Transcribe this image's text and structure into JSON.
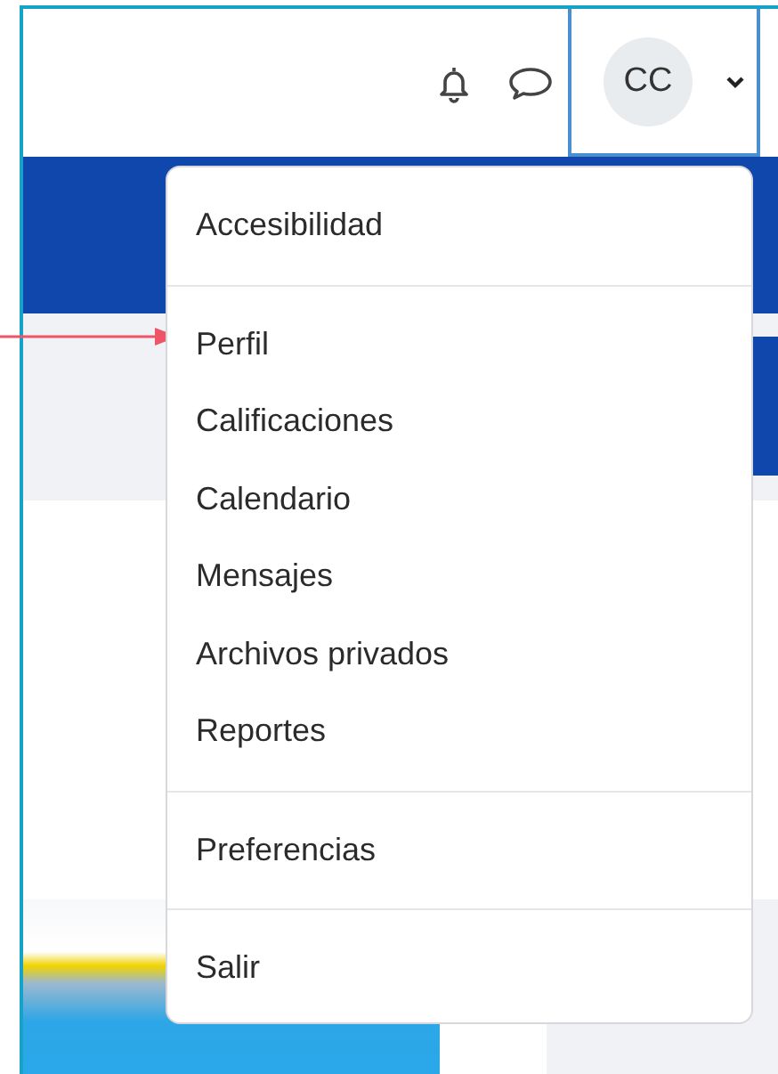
{
  "header": {
    "user_menu": {
      "initials": "CC",
      "expanded": true
    }
  },
  "dropdown": {
    "groups": [
      {
        "items": [
          {
            "label": "Accesibilidad"
          }
        ]
      },
      {
        "items": [
          {
            "label": "Perfil"
          },
          {
            "label": "Calificaciones"
          },
          {
            "label": "Calendario"
          },
          {
            "label": "Mensajes"
          },
          {
            "label": "Archivos privados"
          },
          {
            "label": "Reportes"
          }
        ]
      },
      {
        "items": [
          {
            "label": "Preferencias"
          }
        ]
      },
      {
        "items": [
          {
            "label": "Salir"
          }
        ]
      }
    ]
  }
}
